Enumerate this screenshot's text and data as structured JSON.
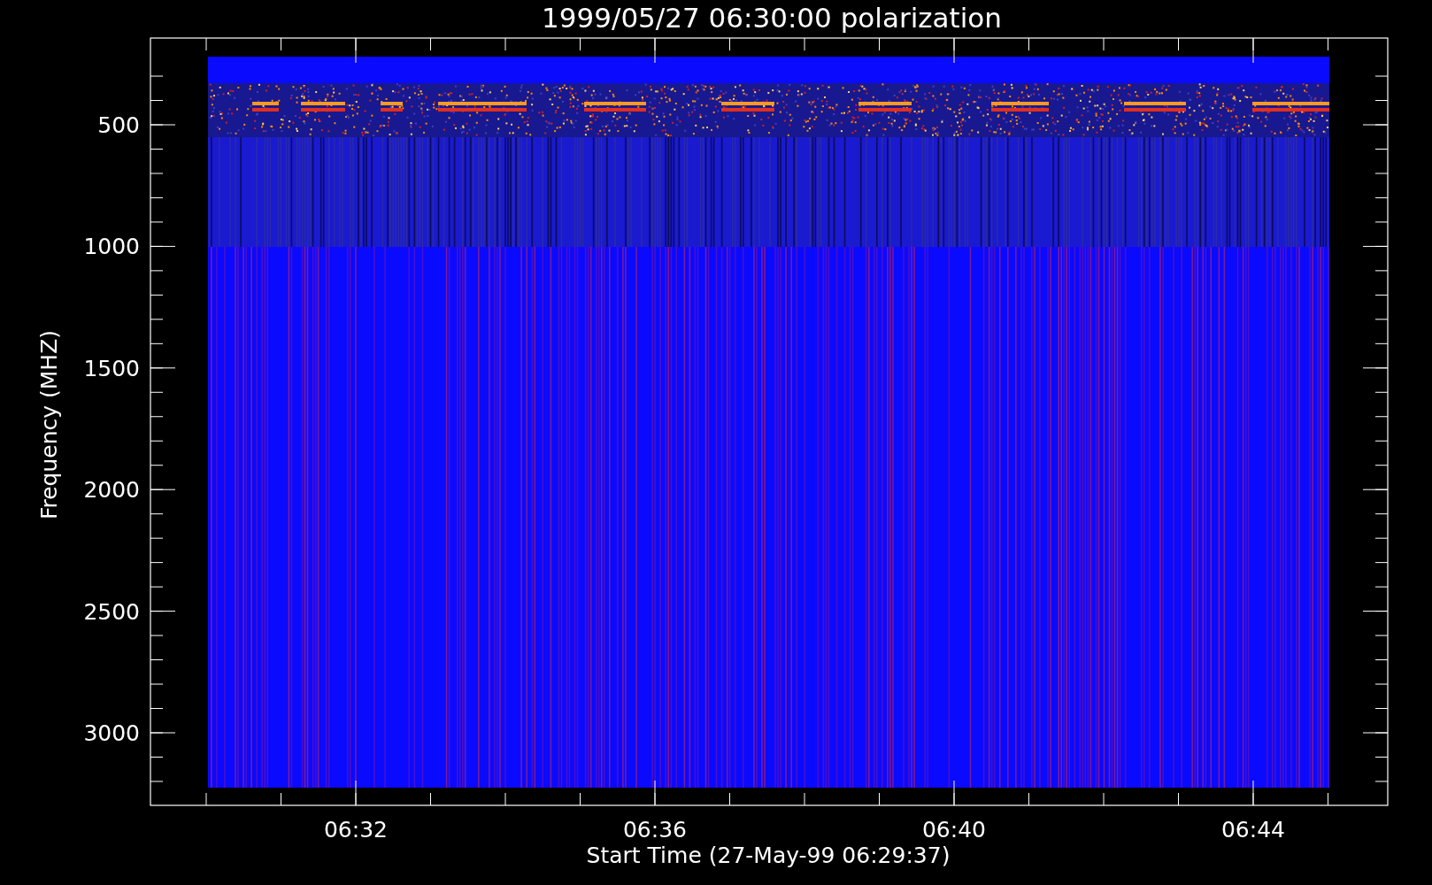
{
  "title": "1999/05/27 06:30:00 polarization",
  "ylabel": "Frequency (MHZ)",
  "xlabel": "Start Time (27-May-99 06:29:37)",
  "yticks": [
    "500",
    "1000",
    "1500",
    "2000",
    "2500",
    "3000"
  ],
  "xticks": [
    "06:32",
    "06:36",
    "06:40",
    "06:44"
  ]
}
